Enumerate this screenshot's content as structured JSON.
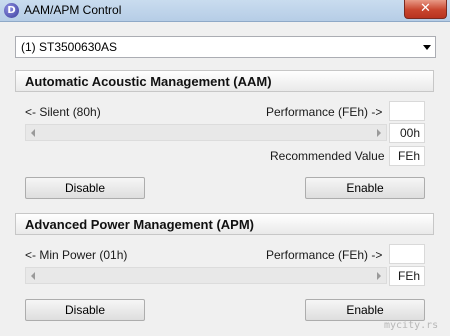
{
  "window": {
    "title": "AAM/APM Control",
    "app_icon_letter": "D",
    "close_glyph": "✕"
  },
  "drive_select": {
    "value": "(1) ST3500630AS"
  },
  "aam": {
    "header": "Automatic Acoustic Management (AAM)",
    "left_label": "<- Silent (80h)",
    "right_label": "Performance (FEh) ->",
    "top_value": "",
    "current_value": "00h",
    "recommended_label": "Recommended Value",
    "recommended_value": "FEh",
    "disable_label": "Disable",
    "enable_label": "Enable"
  },
  "apm": {
    "header": "Advanced Power Management (APM)",
    "left_label": "<- Min Power (01h)",
    "right_label": "Performance (FEh) ->",
    "top_value": "",
    "current_value": "FEh",
    "disable_label": "Disable",
    "enable_label": "Enable"
  },
  "watermark": "mycity.rs",
  "colors": {
    "close_button": "#c8452e",
    "titlebar": "#b6cde6"
  }
}
